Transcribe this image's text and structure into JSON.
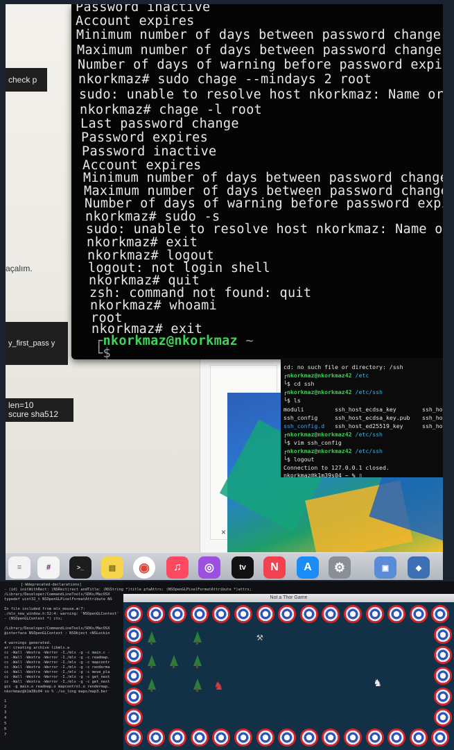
{
  "big_terminal": {
    "lines": [
      "Password inactive",
      "Account expires",
      "Minimum number of days between password change",
      "Maximum number of days between password change",
      "Number of days of warning before password expires",
      "nkorkmaz# sudo chage --mindays 2 root",
      "sudo: unable to resolve host nkorkmaz: Name or se",
      "nkorkmaz# chage -l root",
      "Last password change",
      "Password expires",
      "Password inactive",
      "Account expires",
      "Minimum number of days between password change",
      "Maximum number of days between password change",
      "Number of days of warning before password expires",
      "nkorkmaz# sudo -s",
      "sudo: unable to resolve host nkorkmaz: Name or ser",
      "nkorkmaz# exit",
      "nkorkmaz# logout",
      "logout: not login shell",
      "nkorkmaz# quit",
      "zsh: command not found: quit",
      "nkorkmaz# whoami",
      "root",
      "nkorkmaz# exit"
    ],
    "prompt_user": "nkorkmaz@nkorkmaz",
    "prompt_tilde": "~",
    "prompt_symbol": "$"
  },
  "small_terminal": {
    "error_line": "cd: no such file or directory: /ssh",
    "user": "nkorkmaz@nkorkmaz42",
    "path_etc": "/etc",
    "cmd_cd": "cd ssh",
    "path_etc_ssh": "/etc/ssh",
    "cmd_ls": "ls",
    "ls_row1": [
      "moduli",
      "ssh_host_ecdsa_key",
      "ssh_ho"
    ],
    "ls_row2": [
      "ssh_config",
      "ssh_host_ecdsa_key.pub",
      "ssh_ho"
    ],
    "ls_row3": [
      "ssh_config.d",
      "ssh_host_ed25519_key",
      "ssh_ho"
    ],
    "cmd_vim": "vim ssh_config",
    "cmd_logout": "logout",
    "closed_msg": "Connection to 127.0.0.1 closed.",
    "final_prompt": "nkorkmaz@k1m39s04 ~ % "
  },
  "document": {
    "strip1": "check p",
    "text1": "açalım.",
    "strip2": "y_first_pass y",
    "strip3_line1": "len=10",
    "strip3_line2": "scure sha512",
    "close_glyph": "×"
  },
  "dock": {
    "items": [
      {
        "name": "Reminders",
        "icon": "reminders-icon",
        "color": "#f2f2f2"
      },
      {
        "name": "Slack",
        "icon": "slack-icon",
        "color": "#f4f4f4"
      },
      {
        "name": "Terminal",
        "icon": "terminal-icon",
        "color": "#1d1d1d"
      },
      {
        "name": "Notes",
        "icon": "notes-icon",
        "color": "#f7d54a"
      },
      {
        "name": "Chrome",
        "icon": "chrome-icon",
        "color": "#ffffff"
      },
      {
        "name": "Music",
        "icon": "music-icon",
        "color": "#fb4a5f"
      },
      {
        "name": "Podcasts",
        "icon": "podcasts-icon",
        "color": "#9c4fe0"
      },
      {
        "name": "TV",
        "icon": "tv-icon",
        "color": "#111111"
      },
      {
        "name": "News",
        "icon": "news-icon",
        "color": "#f2414f"
      },
      {
        "name": "App Store",
        "icon": "app-store-icon",
        "color": "#1a8cf5"
      },
      {
        "name": "System Preferences",
        "icon": "settings-icon",
        "color": "#8a8f96"
      },
      {
        "name": "Preview",
        "icon": "preview-icon",
        "color": "#5a8bd6"
      },
      {
        "name": "VirtualBox",
        "icon": "virtualbox-icon",
        "color": "#3d6fb4"
      }
    ],
    "tv_label": "tv",
    "chrome_glyph": "◉",
    "music_glyph": "♫",
    "podcast_glyph": "◎",
    "news_glyph": "N",
    "appstore_glyph": "A",
    "settings_glyph": "⚙"
  },
  "bottom_terminal": {
    "lines": [
      "[-Wdeprecated-declarations]",
      "- (id) initWithRect: (NSRect)rect andTitle: (NSString *)title pfaAttrs: (NSOpenGLPixelFormatAttribute *)attrs;",
      "typedef uint32_t NSOpenGLPixelFormatAttribute NS",
      "",
      "In file included from mlx_mouse.m:7:",
      "./mlx_new_window.h:52:4: warning: 'NSOpenGLContext'",
      "- (NSOpenGLContext *) ctx;",
      "",
      "/Library/Developer/CommandLineTools/SDKs/MacOSX",
      "@interface NSOpenGLContext : NSObject <NSLockin",
      "",
      "4 warnings generated.",
      "ar: creating archive libmlx.a",
      "cc -Wall -Wextra -Werror -I./mlx -g -c main.c -",
      "cc -Wall -Wextra -Werror -I./mlx -g -c readmap.",
      "cc -Wall -Wextra -Werror -I./mlx -g -c mapcontr",
      "cc -Wall -Wextra -Werror -I./mlx -g -c renderma",
      "cc -Wall -Wextra -Werror -I./mlx -g -c move_pla",
      "cc -Wall -Wextra -Werror -I./mlx -g -c get_next",
      "cc -Wall -Wextra -Werror -I./mlx -g -c get_next",
      "gcc -g main.o readmap.o mapcontrol.o rendermap.",
      "nkorkmaz@k1m38s04 so % ./so_long maps/map3.ber",
      "1",
      "2",
      "3",
      "4",
      "5",
      "6",
      "7"
    ],
    "header_line": "/Library/Developer/CommandLineTools/SDKs/MacOSX"
  },
  "game_window": {
    "title": "Not a Thor Game",
    "star_glyph": "★",
    "hammer_glyph": "⚒",
    "player_glyph": "♞"
  }
}
